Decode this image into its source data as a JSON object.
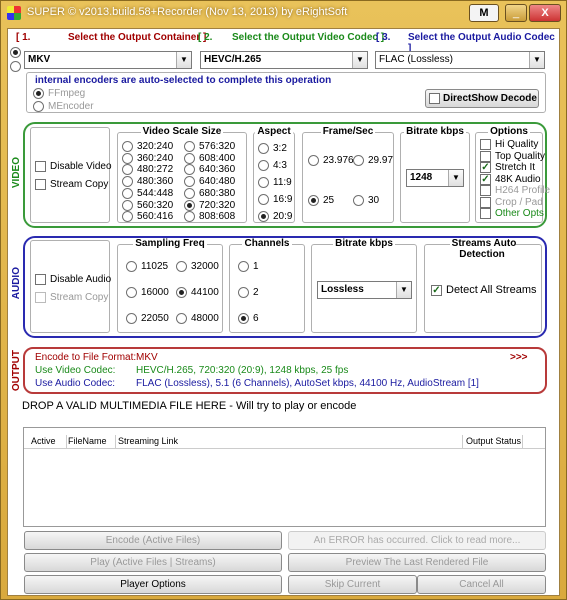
{
  "window": {
    "title": "SUPER © v2013.build.58+Recorder (Nov 13, 2013) by eRightSoft",
    "btn_menu": "M",
    "btn_min": "_",
    "btn_close": "X"
  },
  "top": {
    "num1": "[ 1.",
    "lbl1": "Select the Output Container ]",
    "num2": "[ 2.",
    "lbl2": "Select the Output Video Codec ]",
    "num3": "[ 3.",
    "lbl3": "Select the Output Audio Codec ]",
    "container": "MKV",
    "video_codec": "HEVC/H.265",
    "audio_codec": "FLAC (Lossless)",
    "encoders_note": "internal encoders are auto-selected to complete this operation",
    "ffmpeg": "FFmpeg",
    "mencoder": "MEncoder",
    "directshow": "DirectShow Decode"
  },
  "video": {
    "section_label": "VIDEO",
    "disable": "Disable Video",
    "stream_copy": "Stream Copy",
    "scale_title": "Video Scale Size",
    "scales": [
      "320:240",
      "576:320",
      "360:240",
      "608:400",
      "480:272",
      "640:360",
      "480:360",
      "640:480",
      "544:448",
      "680:380",
      "560:320",
      "720:320",
      "560:416",
      "808:608"
    ],
    "aspect_title": "Aspect",
    "aspects": [
      "3:2",
      "4:3",
      "11:9",
      "16:9",
      "20:9"
    ],
    "fps_title": "Frame/Sec",
    "fps": [
      "23.976",
      "29.97",
      "25",
      "30"
    ],
    "bitrate_title": "Bitrate  kbps",
    "bitrate": "1248",
    "options_title": "Options",
    "options": [
      "Hi Quality",
      "Top Quality",
      "Stretch It",
      "48K Audio",
      "H264 Profile",
      "Crop / Pad",
      "Other Opts"
    ]
  },
  "audio": {
    "section_label": "AUDIO",
    "disable": "Disable Audio",
    "stream_copy": "Stream Copy",
    "freq_title": "Sampling Freq",
    "freqs": [
      "11025",
      "32000",
      "16000",
      "44100",
      "22050",
      "48000"
    ],
    "ch_title": "Channels",
    "channels": [
      "1",
      "2",
      "6"
    ],
    "bitrate_title": "Bitrate  kbps",
    "bitrate": "Lossless",
    "streams_title": "Streams Auto Detection",
    "detect_all": "Detect All Streams"
  },
  "output": {
    "section_label": "OUTPUT",
    "l1": "Encode to File Format:",
    "v1": "MKV",
    "more": ">>>",
    "l2": "Use Video Codec:",
    "v2": "HEVC/H.265,  720:320 (20:9),  1248 kbps,  25 fps",
    "l3": "Use Audio Codec:",
    "v3": "FLAC (Lossless),  5.1 (6 Channels),  AutoSet kbps,  44100 Hz,  AudioStream [1]"
  },
  "drop_text": "DROP A VALID MULTIMEDIA FILE HERE - Will try to play or encode",
  "table": {
    "cols": [
      "Active",
      "FileName",
      "Streaming Link",
      "Output Status"
    ]
  },
  "buttons": {
    "encode": "Encode (Active Files)",
    "error": "An ERROR has occurred. Click to read more...",
    "play": "Play (Active Files | Streams)",
    "preview": "Preview The Last Rendered File",
    "player_options": "Player Options",
    "skip": "Skip Current",
    "cancel": "Cancel All"
  }
}
